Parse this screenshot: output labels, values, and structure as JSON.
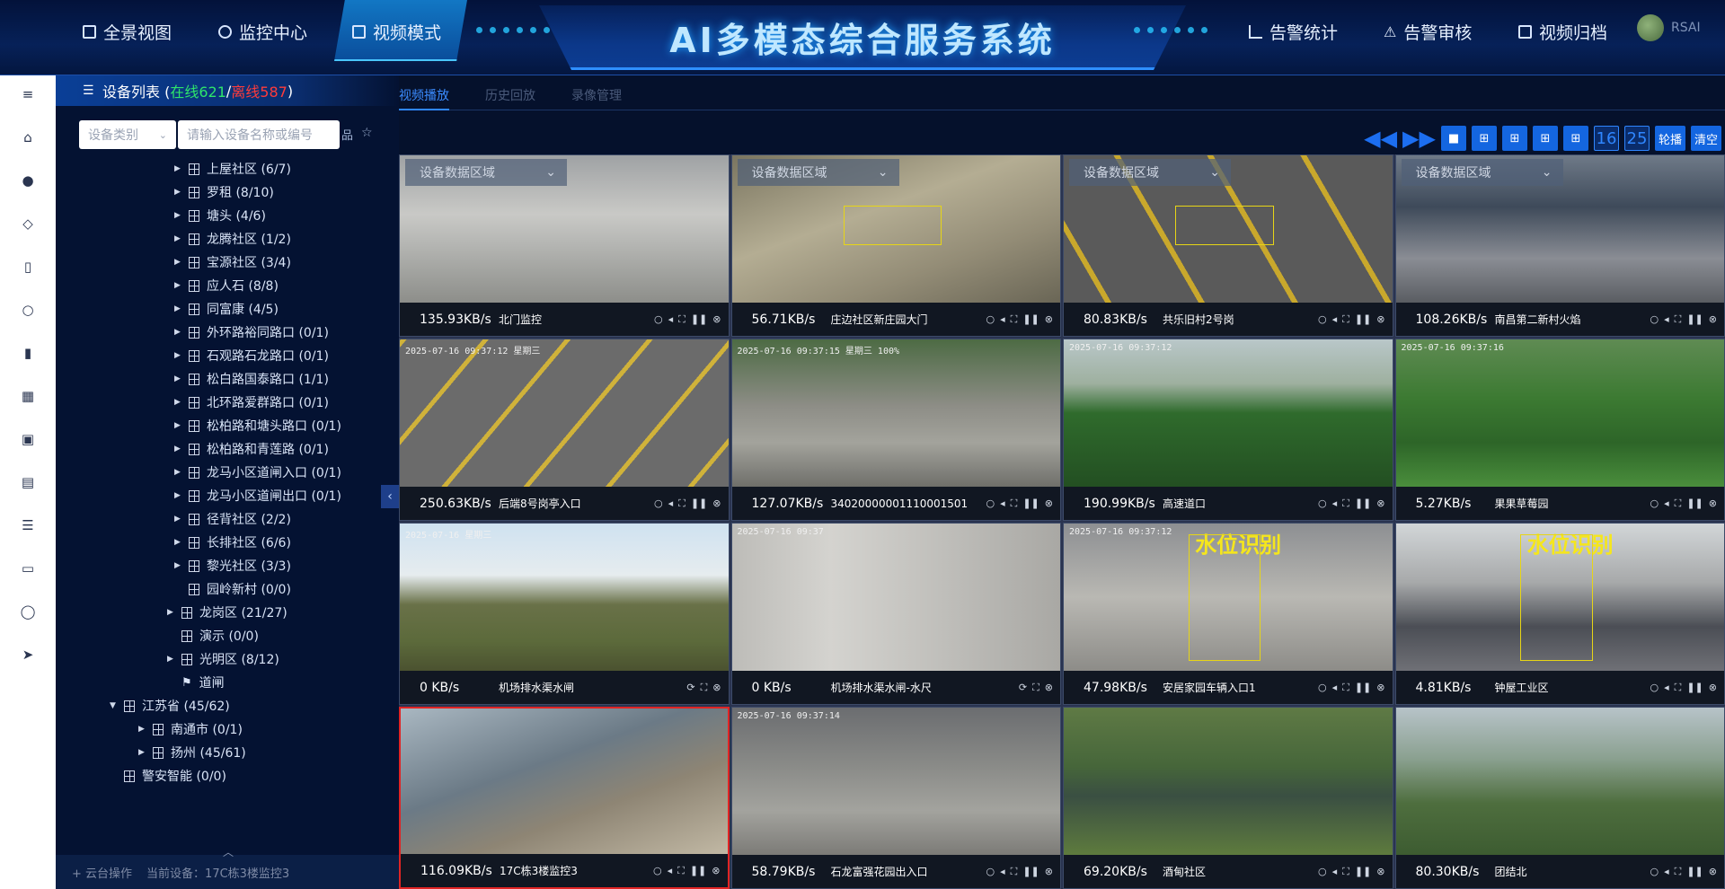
{
  "nav": {
    "left": [
      {
        "label": "全景视图",
        "icon": "panorama-icon"
      },
      {
        "label": "监控中心",
        "icon": "target-icon"
      },
      {
        "label": "视频模式",
        "icon": "video-icon",
        "active": true
      }
    ],
    "right": [
      {
        "label": "告警统计",
        "icon": "chart-icon"
      },
      {
        "label": "告警审核",
        "icon": "warning-icon"
      },
      {
        "label": "视频归档",
        "icon": "archive-icon"
      }
    ],
    "title": "AI多模态综合服务系统",
    "user": "RSAI"
  },
  "sidebar": [
    "menu-icon",
    "home-icon",
    "camera-icon",
    "shield-icon",
    "paint-icon",
    "user-icon",
    "document-icon",
    "table-icon",
    "grid-icon",
    "layout-icon",
    "list-icon",
    "folder-icon",
    "bulb-icon",
    "send-icon"
  ],
  "device_panel": {
    "title": "设备列表 (",
    "online": "在线621",
    "sep": " / ",
    "offline": "离线587",
    "close": " )",
    "category_placeholder": "设备类别",
    "search_placeholder": "请输入设备名称或编号",
    "tree": [
      {
        "label": "上屋社区 (6/7)",
        "level": 3,
        "arrow": true
      },
      {
        "label": "罗租 (8/10)",
        "level": 3,
        "arrow": true
      },
      {
        "label": "塘头 (4/6)",
        "level": 3,
        "arrow": true
      },
      {
        "label": "龙腾社区 (1/2)",
        "level": 3,
        "arrow": true
      },
      {
        "label": "宝源社区 (3/4)",
        "level": 3,
        "arrow": true
      },
      {
        "label": "应人石 (8/8)",
        "level": 3,
        "arrow": true
      },
      {
        "label": "同富康 (4/5)",
        "level": 3,
        "arrow": true
      },
      {
        "label": "外环路裕同路口 (0/1)",
        "level": 3,
        "arrow": true
      },
      {
        "label": "石观路石龙路口 (0/1)",
        "level": 3,
        "arrow": true
      },
      {
        "label": "松白路国泰路口 (1/1)",
        "level": 3,
        "arrow": true
      },
      {
        "label": "北环路爱群路口 (0/1)",
        "level": 3,
        "arrow": true
      },
      {
        "label": "松柏路和塘头路口 (0/1)",
        "level": 3,
        "arrow": true
      },
      {
        "label": "松柏路和青莲路 (0/1)",
        "level": 3,
        "arrow": true
      },
      {
        "label": "龙马小区道闸入口 (0/1)",
        "level": 3,
        "arrow": true
      },
      {
        "label": "龙马小区道闸出口 (0/1)",
        "level": 3,
        "arrow": true
      },
      {
        "label": "径背社区 (2/2)",
        "level": 3,
        "arrow": true
      },
      {
        "label": "长排社区 (6/6)",
        "level": 3,
        "arrow": true
      },
      {
        "label": "黎光社区 (3/3)",
        "level": 3,
        "arrow": true
      },
      {
        "label": "园岭新村 (0/0)",
        "level": 3,
        "arrow": false
      },
      {
        "label": "龙岗区 (21/27)",
        "level": 2,
        "arrow": true
      },
      {
        "label": "演示 (0/0)",
        "level": 2,
        "arrow": false
      },
      {
        "label": "光明区 (8/12)",
        "level": 2,
        "arrow": true
      },
      {
        "label": "道闸",
        "level": 2,
        "arrow": false,
        "flag": true
      },
      {
        "label": "江苏省 (45/62)",
        "level": 0,
        "arrow": true,
        "open": true
      },
      {
        "label": "南通市 (0/1)",
        "level": 1,
        "arrow": true
      },
      {
        "label": "扬州 (45/61)",
        "level": 1,
        "arrow": true
      },
      {
        "label": "警安智能 (0/0)",
        "level": 0,
        "arrow": false
      }
    ],
    "footer": {
      "ptz": "云台操作",
      "current": "当前设备：17C栋3楼监控3"
    }
  },
  "tabs": [
    "视频播放",
    "历史回放",
    "录像管理"
  ],
  "toolbar": {
    "counts": [
      "16",
      "25"
    ],
    "poll": "轮播",
    "clear": "清空"
  },
  "region_select": "设备数据区域",
  "cells": [
    {
      "rate": "135.93KB/s",
      "name": "北门监控",
      "region": true,
      "scene": "gate"
    },
    {
      "rate": "56.71KB/s",
      "name": "庄边社区新庄园大门",
      "region": true,
      "scene": "ground"
    },
    {
      "rate": "80.83KB/s",
      "name": "共乐旧村2号岗",
      "region": true,
      "scene": "yellowbox"
    },
    {
      "rate": "108.26KB/s",
      "name": "南昌第二新村火焰",
      "region": true,
      "scene": "market"
    },
    {
      "rate": "250.63KB/s",
      "name": "后端8号岗亭入口",
      "scene": "yellowbox2",
      "ts": "2025-07-16 09:37:12 星期三"
    },
    {
      "rate": "127.07KB/s",
      "name": "34020000001110001501",
      "scene": "parking",
      "ts": "2025-07-16 09:37:15 星期三 100%"
    },
    {
      "rate": "190.99KB/s",
      "name": "高速道口",
      "scene": "valley",
      "ts": "2025-07-16 09:37:12"
    },
    {
      "rate": "5.27KB/s",
      "name": "果果草莓园",
      "scene": "bridge",
      "ts": "2025-07-16 09:37:16"
    },
    {
      "rate": "0 KB/s",
      "name": "机场排水渠水闸",
      "scene": "river",
      "ts": "2025-07-16 星期三"
    },
    {
      "rate": "0 KB/s",
      "name": "机场排水渠水闸-水尺",
      "scene": "gauge",
      "ts": "2025-07-16 09:37"
    },
    {
      "rate": "47.98KB/s",
      "name": "安居家园车辆入口1",
      "scene": "water1",
      "overlay": "水位识别",
      "ts": "2025-07-16 09:37:12"
    },
    {
      "rate": "4.81KB/s",
      "name": "钟屋工业区",
      "scene": "car",
      "overlay": "水位识别"
    },
    {
      "rate": "116.09KB/s",
      "name": "17C栋3楼监控3",
      "scene": "construction",
      "selected": true
    },
    {
      "rate": "58.79KB/s",
      "name": "石龙富强花园出入口",
      "scene": "street",
      "ts": "2025-07-16 09:37:14"
    },
    {
      "rate": "69.20KB/s",
      "name": "酒甸社区",
      "scene": "pond"
    },
    {
      "rate": "80.30KB/s",
      "name": "团结北",
      "scene": "tower"
    }
  ]
}
